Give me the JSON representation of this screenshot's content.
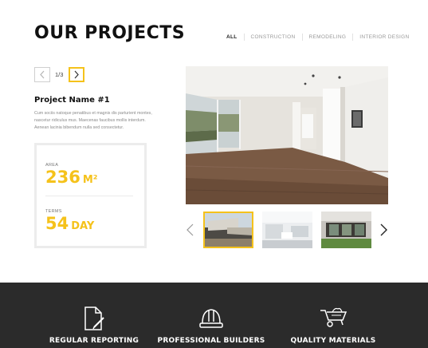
{
  "header": {
    "title": "OUR PROJECTS"
  },
  "filters": [
    {
      "label": "ALL",
      "active": true
    },
    {
      "label": "CONSTRUCTION",
      "active": false
    },
    {
      "label": "REMODELING",
      "active": false
    },
    {
      "label": "INTERIOR DESIGN",
      "active": false
    }
  ],
  "pager": {
    "count": "1/3",
    "prev_icon": "chevron-left-icon",
    "next_icon": "chevron-right-icon"
  },
  "project": {
    "name": "Project Name #1",
    "description": "Cum sociis natoque penatibus et magnis dis parturient montes, nascetur ridiculus mus. Maecenas faucibus mollis interdum. Aenean lacinia bibendum nulla sed consectetur."
  },
  "stats": {
    "area_label": "AREA",
    "area_value": "236",
    "area_unit": "M²",
    "terms_label": "TERMS",
    "terms_value": "54",
    "terms_unit": "DAY"
  },
  "gallery": {
    "active_index": 0,
    "thumb_count": 3
  },
  "features": [
    {
      "label": "REGULAR REPORTING",
      "icon": "document-edit-icon"
    },
    {
      "label": "PROFESSIONAL BUILDERS",
      "icon": "hard-hat-icon"
    },
    {
      "label": "QUALITY MATERIALS",
      "icon": "wheelbarrow-icon"
    }
  ],
  "colors": {
    "accent": "#f5c21b",
    "footer_bg": "#2b2b2b",
    "text_dark": "#111111",
    "muted": "#8a8a8a"
  }
}
